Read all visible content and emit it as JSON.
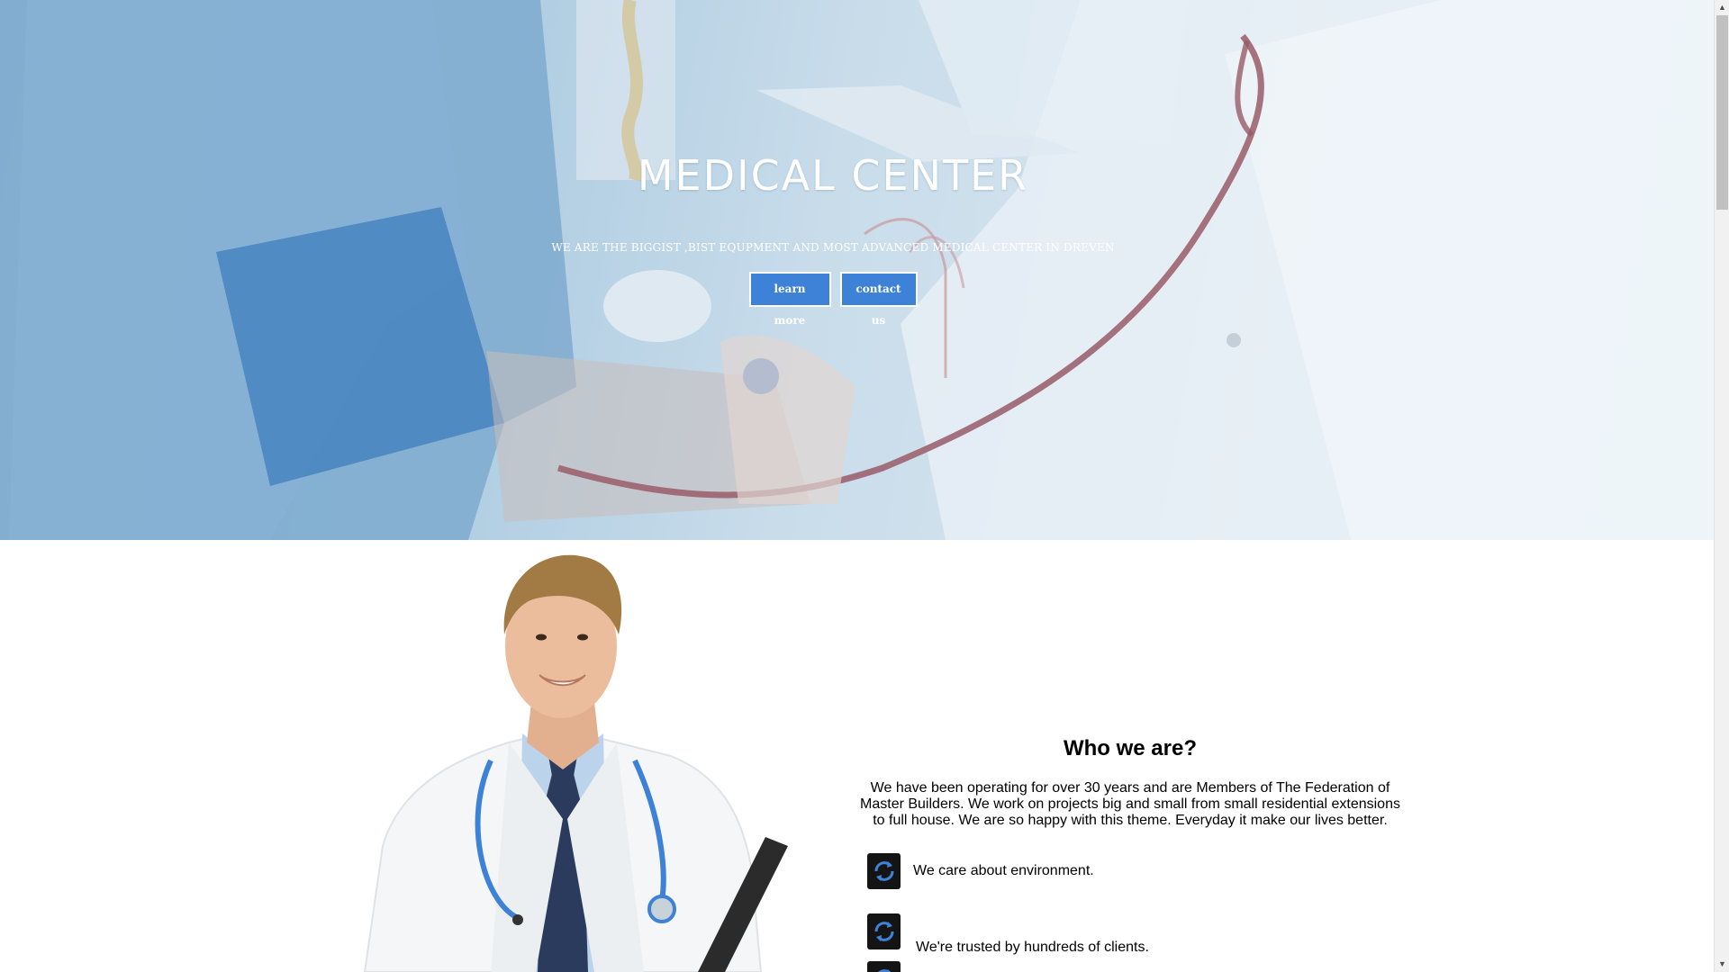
{
  "hero": {
    "title": "MEDICAL CENTER",
    "subtitle": "WE ARE THE BIGGIST ,BIST EQUPMENT AND MOST ADVANCED MEDICAL CENTER IN DREVEN",
    "learn_more_label": "learn more",
    "contact_label": "contact us"
  },
  "about": {
    "title": "Who we are?",
    "description": "We have been operating for over 30 years and are Members of The Federation of Master Builders. We work on projects big and small from small residential extensions to full house. We are so happy with this theme. Everyday it make our lives better.",
    "features": [
      {
        "label": "We care about environment.",
        "icon": "refresh-icon"
      },
      {
        "label": "We're trusted by hundreds of clients.",
        "icon": "refresh-icon"
      },
      {
        "label": "",
        "icon": "refresh-icon"
      }
    ]
  },
  "colors": {
    "accent": "#3d82d6",
    "hero_tint": "#a9c9df",
    "icon_bg": "#141414"
  }
}
